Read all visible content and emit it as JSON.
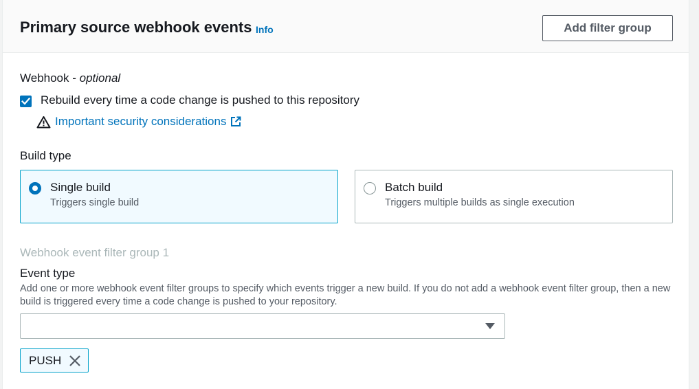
{
  "header": {
    "title": "Primary source webhook events",
    "info_label": "Info",
    "add_filter_group_label": "Add filter group"
  },
  "webhook": {
    "label": "Webhook",
    "optional_label": "optional",
    "rebuild_checkbox_label": "Rebuild every time a code change is pushed to this repository",
    "rebuild_checked": true,
    "security_link_label": "Important security considerations"
  },
  "build_type": {
    "label": "Build type",
    "options": [
      {
        "title": "Single build",
        "description": "Triggers single build",
        "selected": true
      },
      {
        "title": "Batch build",
        "description": "Triggers multiple builds as single execution",
        "selected": false
      }
    ]
  },
  "filter_group": {
    "title": "Webhook event filter group 1",
    "event_type_label": "Event type",
    "event_type_description": "Add one or more webhook event filter groups to specify which events trigger a new build. If you do not add a webhook event filter group, then a new build is triggered every time a code change is pushed to your repository.",
    "select_value": "",
    "tokens": [
      "PUSH"
    ]
  },
  "colors": {
    "accent": "#0073bb",
    "selected_tile_bg": "#f1faff",
    "selected_tile_border": "#00a1c9"
  },
  "icons": {
    "info": "info-link",
    "warning": "warning-triangle-icon",
    "external": "external-link-icon",
    "caret": "caret-down-icon",
    "dismiss": "close-icon",
    "check": "check-icon"
  }
}
